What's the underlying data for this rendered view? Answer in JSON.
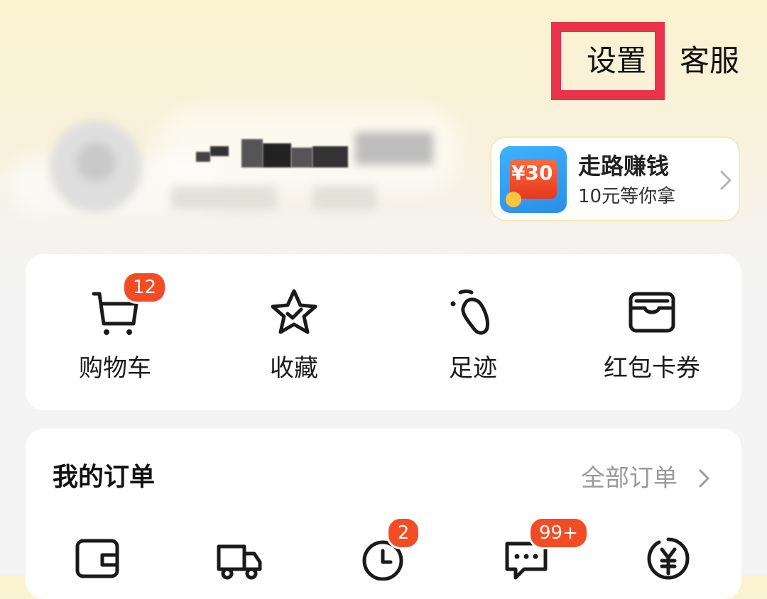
{
  "header": {
    "settings_label": "设置",
    "service_label": "客服"
  },
  "walk_card": {
    "title": "走路赚钱",
    "subtitle": "10元等你拿",
    "amount": "¥30"
  },
  "shortcuts": [
    {
      "label": "购物车",
      "icon": "cart-icon",
      "badge": "12"
    },
    {
      "label": "收藏",
      "icon": "star-icon"
    },
    {
      "label": "足迹",
      "icon": "footprint-icon"
    },
    {
      "label": "红包卡券",
      "icon": "wallet-card-icon"
    }
  ],
  "orders": {
    "title": "我的订单",
    "all_label": "全部订单",
    "icons": [
      {
        "icon": "wallet-icon"
      },
      {
        "icon": "truck-icon"
      },
      {
        "icon": "clock-icon",
        "badge": "2"
      },
      {
        "icon": "message-icon",
        "badge": "99+"
      },
      {
        "icon": "refund-icon"
      }
    ]
  },
  "colors": {
    "badge": "#f24c25",
    "highlight": "#e8334a",
    "muted_text": "#9a9a9a"
  }
}
